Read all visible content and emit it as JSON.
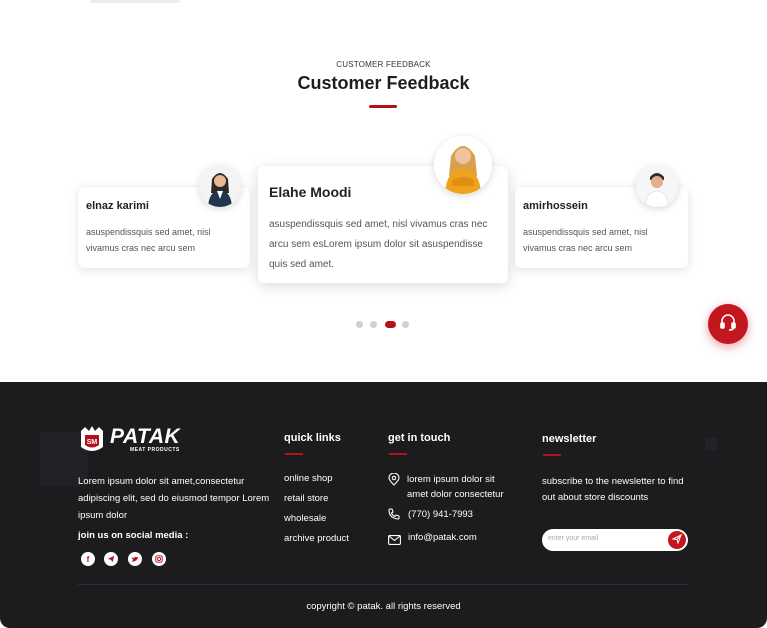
{
  "feedback": {
    "subtitle": "CUSTOMER FEEDBACK",
    "title": "Customer Feedback",
    "testimonials": [
      {
        "name": "elnaz karimi",
        "text": "asuspendissquis sed amet, nisl vivamus cras nec arcu sem"
      },
      {
        "name": "Elahe Moodi",
        "text": "asuspendissquis sed amet, nisl vivamus cras nec arcu sem esLorem ipsum dolor sit asuspendisse quis sed amet."
      },
      {
        "name": "amirhossein",
        "text": "asuspendissquis sed amet, nisl vivamus cras nec arcu sem"
      }
    ],
    "pagination": {
      "count": 4,
      "active": 3
    }
  },
  "footer": {
    "logo": {
      "name": "PATAK",
      "tagline": "MEAT PRODUCTS"
    },
    "description": "Lorem ipsum dolor sit amet,consectetur adipiscing elit, sed do eiusmod tempor Lorem ipsum dolor",
    "social_label": "join us on social media :",
    "social_icons": [
      "facebook-icon",
      "telegram-icon",
      "twitter-icon",
      "instagram-icon"
    ],
    "quick_links": {
      "title": "quick links",
      "items": [
        "online shop",
        "retail store",
        "wholesale",
        "archive product"
      ]
    },
    "get_in_touch": {
      "title": "get in touch",
      "address_line1": "lorem ipsum dolor sit",
      "address_line2": "amet dolor  consectetur",
      "phone": "(770) 941-7993",
      "email": "info@patak.com"
    },
    "newsletter": {
      "title": "newsletter",
      "text": "subscribe to the newsletter to find out about store discounts",
      "placeholder": "enter your email"
    },
    "copyright": "copyright © patak. all rights reserved"
  },
  "colors": {
    "accent": "#b3121b",
    "footer_bg": "#1c1c1f"
  }
}
